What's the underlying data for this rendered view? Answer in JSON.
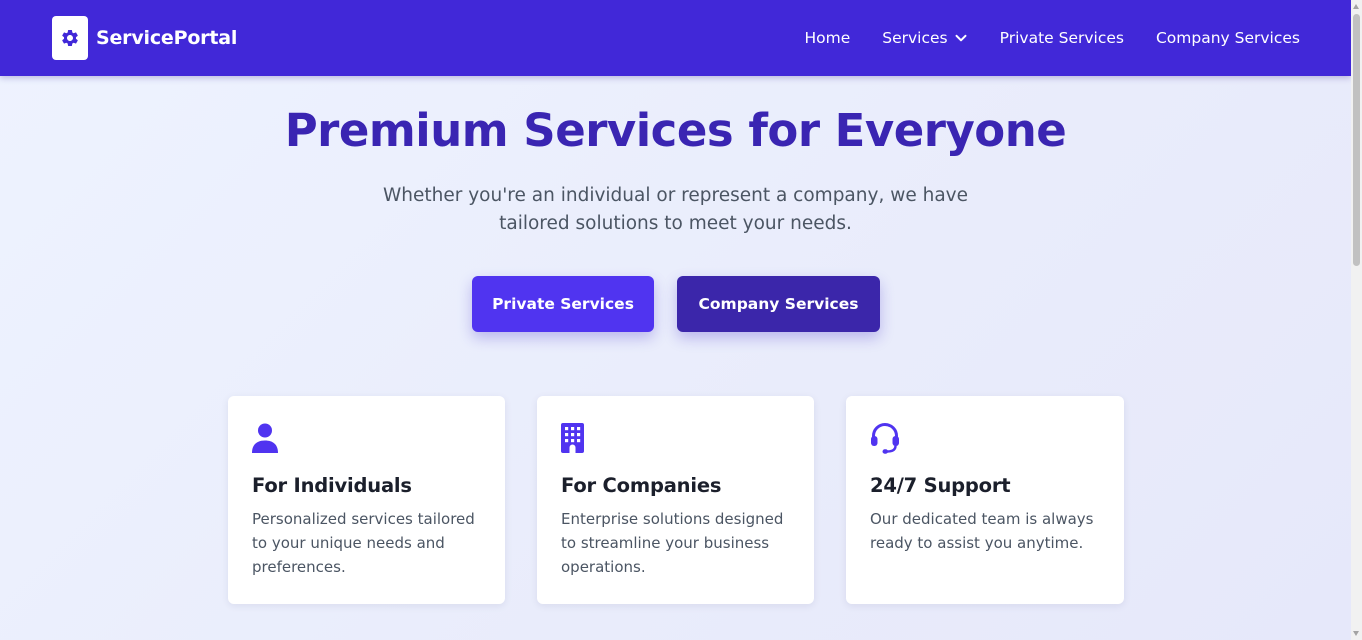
{
  "colors": {
    "nav_bg": "#4128d8",
    "accent": "#5034f0",
    "accent_dark": "#3b26aa",
    "title": "#3a25b2"
  },
  "nav": {
    "brand_name": "ServicePortal",
    "brand_icon": "gear-icon",
    "links": [
      {
        "label": "Home"
      },
      {
        "label": "Services",
        "icon": "chevron-down-icon"
      },
      {
        "label": "Private Services"
      },
      {
        "label": "Company Services"
      }
    ]
  },
  "hero": {
    "title": "Premium Services for Everyone",
    "subtitle": "Whether you're an individual or represent a company, we have tailored solutions to meet your needs.",
    "buttons": {
      "private": "Private Services",
      "company": "Company Services"
    }
  },
  "features": [
    {
      "icon": "user-icon",
      "title": "For Individuals",
      "text": "Personalized services tailored to your unique needs and preferences."
    },
    {
      "icon": "building-icon",
      "title": "For Companies",
      "text": "Enterprise solutions designed to streamline your business operations."
    },
    {
      "icon": "headset-icon",
      "title": "24/7 Support",
      "text": "Our dedicated team is always ready to assist you anytime."
    }
  ]
}
